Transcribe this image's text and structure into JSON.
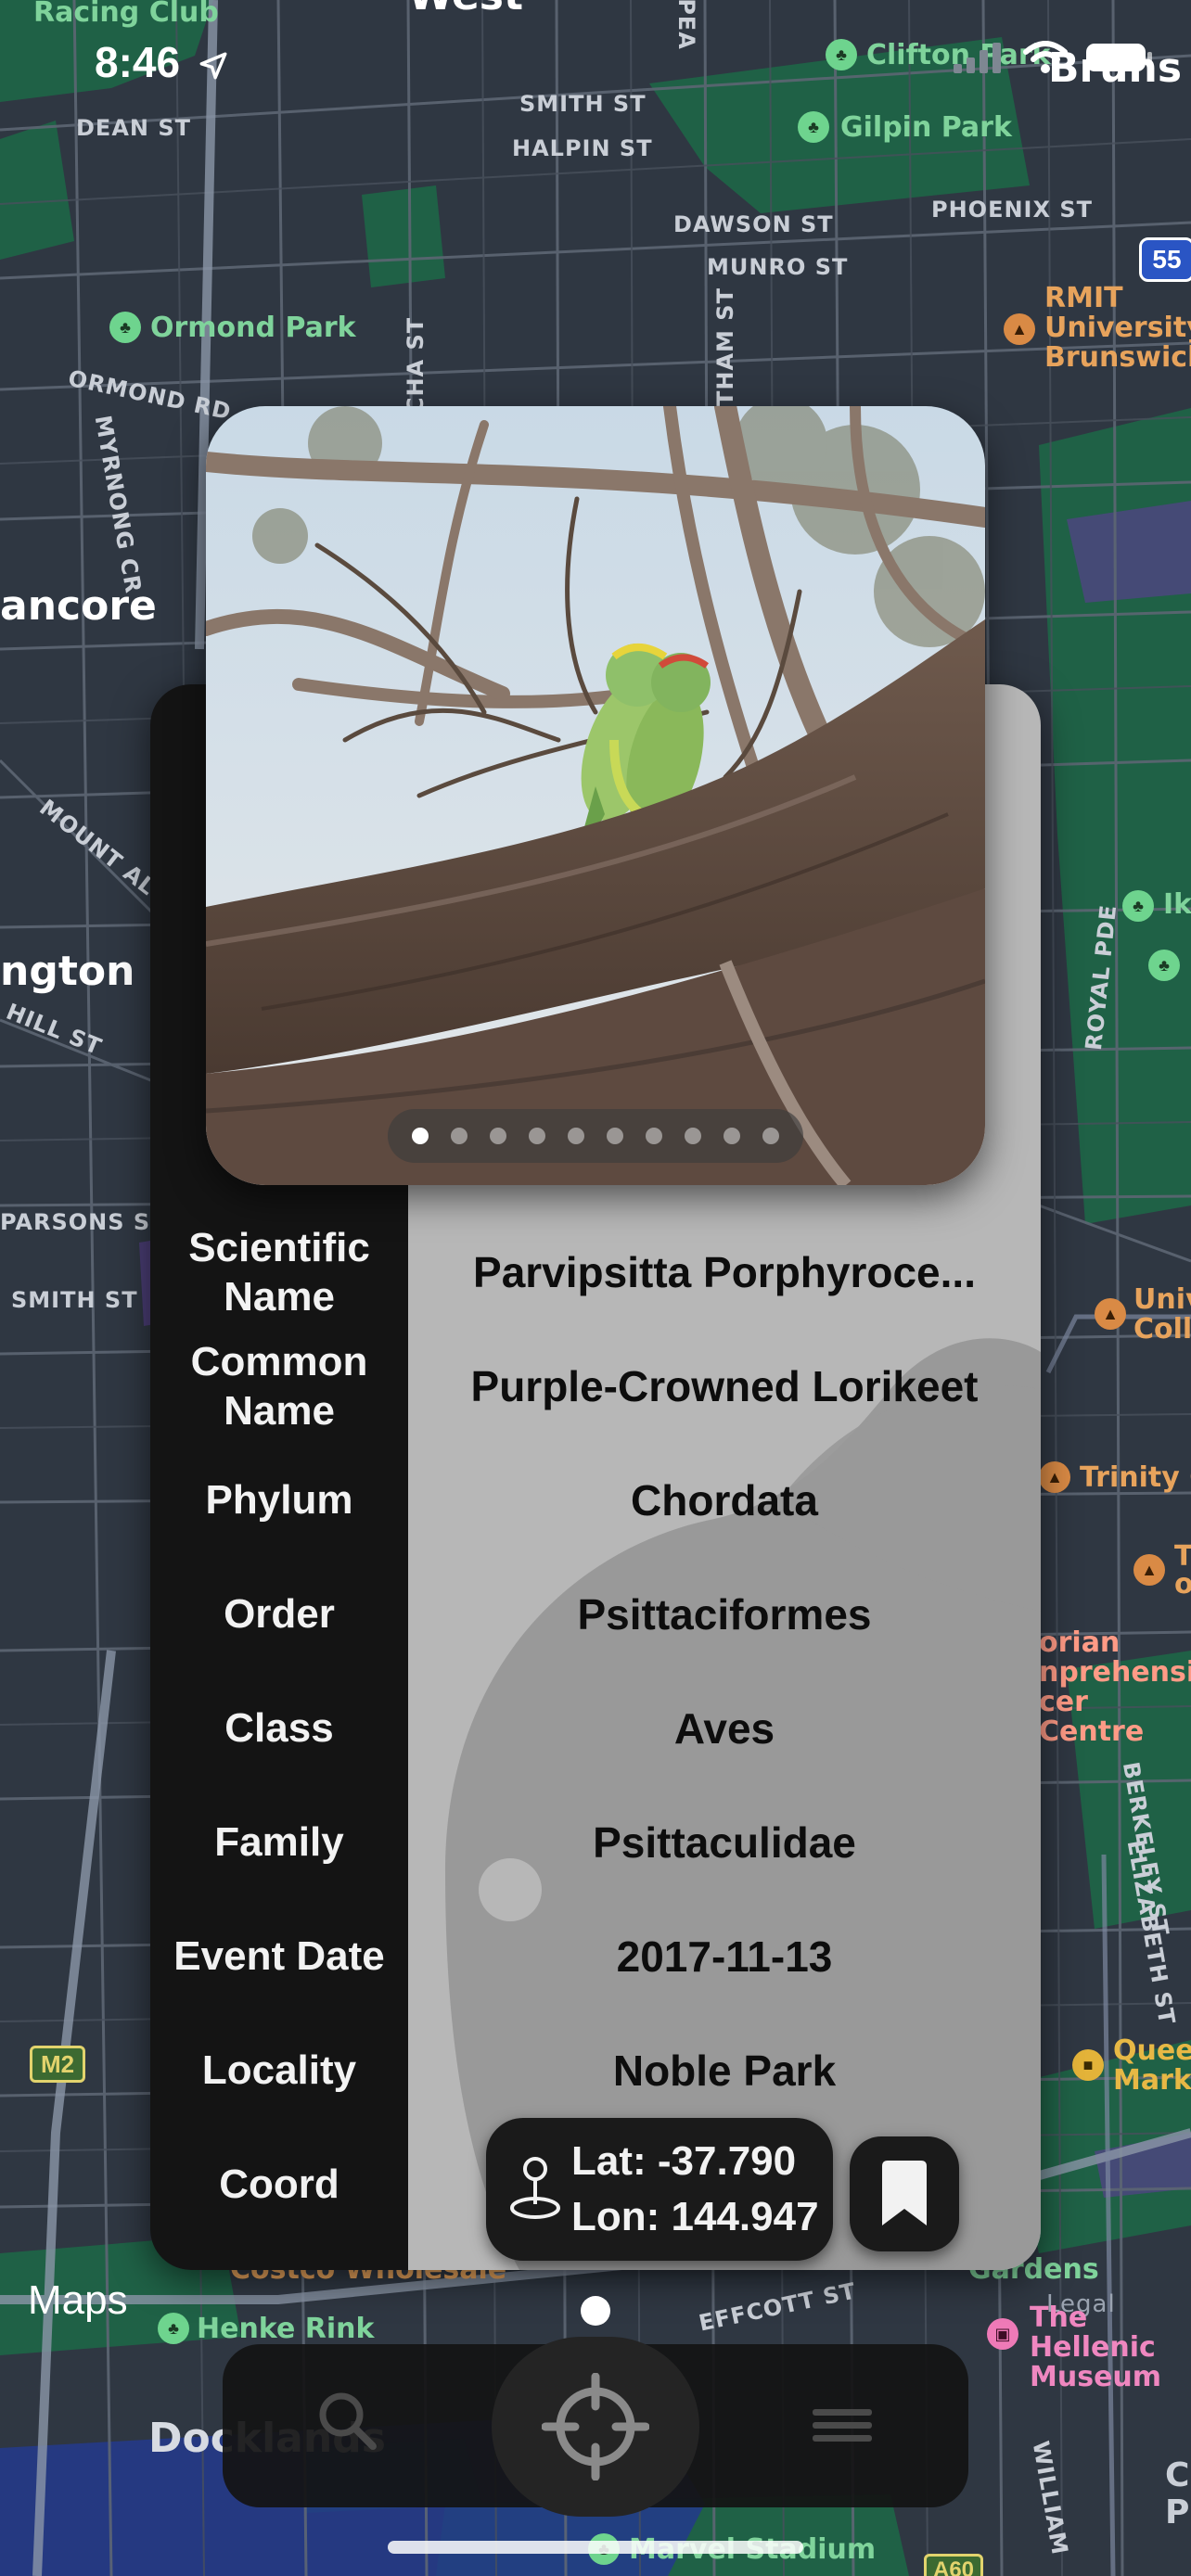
{
  "status_bar": {
    "time": "8:46"
  },
  "map": {
    "labels": {
      "racing_club": "Racing Club",
      "west": "West",
      "dean_st": "DEAN ST",
      "smith_st": "SMITH ST",
      "halpin_st": "HALPIN ST",
      "pea": "PEA",
      "clifton_park": "Clifton Park",
      "bruns": "Bruns",
      "gilpin_park": "Gilpin Park",
      "phoenix_st": "PHOENIX ST",
      "dawson_st": "DAWSON ST",
      "munro_st": "MUNRO ST",
      "route_55": "55",
      "ormond_park": "Ormond Park",
      "cha_st": "CHA ST",
      "tham_st": "THAM ST",
      "rmit": "RMIT University Brunswick",
      "ormond_rd": "ORMOND RD",
      "myrnong_cr": "MYRNONG CR",
      "ancore": "ancore",
      "mount_al": "MOUNT AL",
      "ngton": "ngton",
      "hill_st": "HILL ST",
      "royal_pde": "ROYAL PDE",
      "ik": "Ik",
      "parsons_st": "PARSONS ST",
      "smith_st_2": "SMITH ST",
      "univ_coll": "Univ Coll",
      "trinity": "Trinity C",
      "t_o": "T o",
      "comprehensive": "orian nprehensive cer Centre",
      "berkeley_st": "BERKELEY ST",
      "elizabeth_st": "ELIZABETH ST",
      "queen_market": "Queen Marke",
      "m2": "M2",
      "costco": "Costco Wholesale",
      "gardens": "Gardens",
      "legal": "Legal",
      "henke_rink": "Henke Rink",
      "effcott_st": "EFFCOTT ST",
      "hellenic": "The Hellenic Museum",
      "docklands": "Docklands",
      "william": "WILLIAM",
      "marvel_stadium": "Marvel Stadium",
      "a60": "A60",
      "c_p": "C P"
    },
    "attribution": "Maps"
  },
  "card": {
    "photo": {
      "page_count": 10,
      "active_page": 0,
      "subject": "two lorikeets perched on gum tree branch"
    },
    "rows": [
      {
        "label": "Scientific Name",
        "value": "Parvipsitta Porphyroce..."
      },
      {
        "label": "Common Name",
        "value": "Purple-Crowned Lorikeet"
      },
      {
        "label": "Phylum",
        "value": "Chordata"
      },
      {
        "label": "Order",
        "value": "Psittaciformes"
      },
      {
        "label": "Class",
        "value": "Aves"
      },
      {
        "label": "Family",
        "value": "Psittaculidae"
      },
      {
        "label": "Event Date",
        "value": "2017-11-13"
      },
      {
        "label": "Locality",
        "value": "Noble Park"
      },
      {
        "label": "Coord",
        "value": ""
      }
    ],
    "coord": {
      "lat": "Lat: -37.790",
      "lon": "Lon: 144.947",
      "icon": "map-pin-icon"
    },
    "bookmark_icon": "bookmark-icon"
  },
  "tabbar": {
    "search_icon": "magnifying-glass-icon",
    "locate_icon": "crosshair-icon",
    "menu_icon": "hamburger-icon"
  },
  "colors": {
    "map_bg": "#2f3742",
    "park": "#1f6b4a",
    "label_col": "#141414",
    "value_col": "#b7b7b7",
    "accent_orange": "#d98a45"
  }
}
